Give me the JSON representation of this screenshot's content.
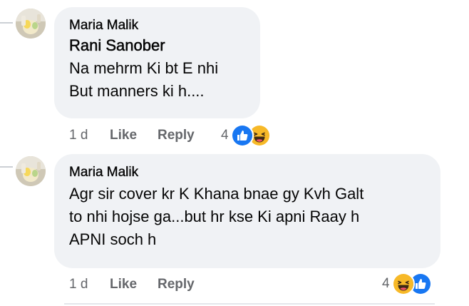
{
  "comments": [
    {
      "author": "Maria Malik",
      "mention": "Rani Sanober",
      "lines": [
        "Na mehrm Ki bt E nhi",
        "But manners ki h...."
      ],
      "time": "1 d",
      "like_label": "Like",
      "reply_label": "Reply",
      "reaction_count": "4",
      "reactions": [
        "like-icon",
        "haha-icon"
      ]
    },
    {
      "author": "Maria Malik",
      "lines": [
        "Agr sir cover kr K Khana bnae gy Kvh Galt",
        "to nhi hojse ga...but hr kse Ki apni Raay h",
        "APNI soch h"
      ],
      "time": "1 d",
      "like_label": "Like",
      "reply_label": "Reply",
      "reaction_count": "4",
      "reactions": [
        "haha-icon",
        "like-icon"
      ]
    }
  ],
  "colors": {
    "bubble_bg": "#f0f2f5",
    "meta_text": "#65676b",
    "like_blue": "#1877f2",
    "haha_yellow": "#f7b928"
  }
}
